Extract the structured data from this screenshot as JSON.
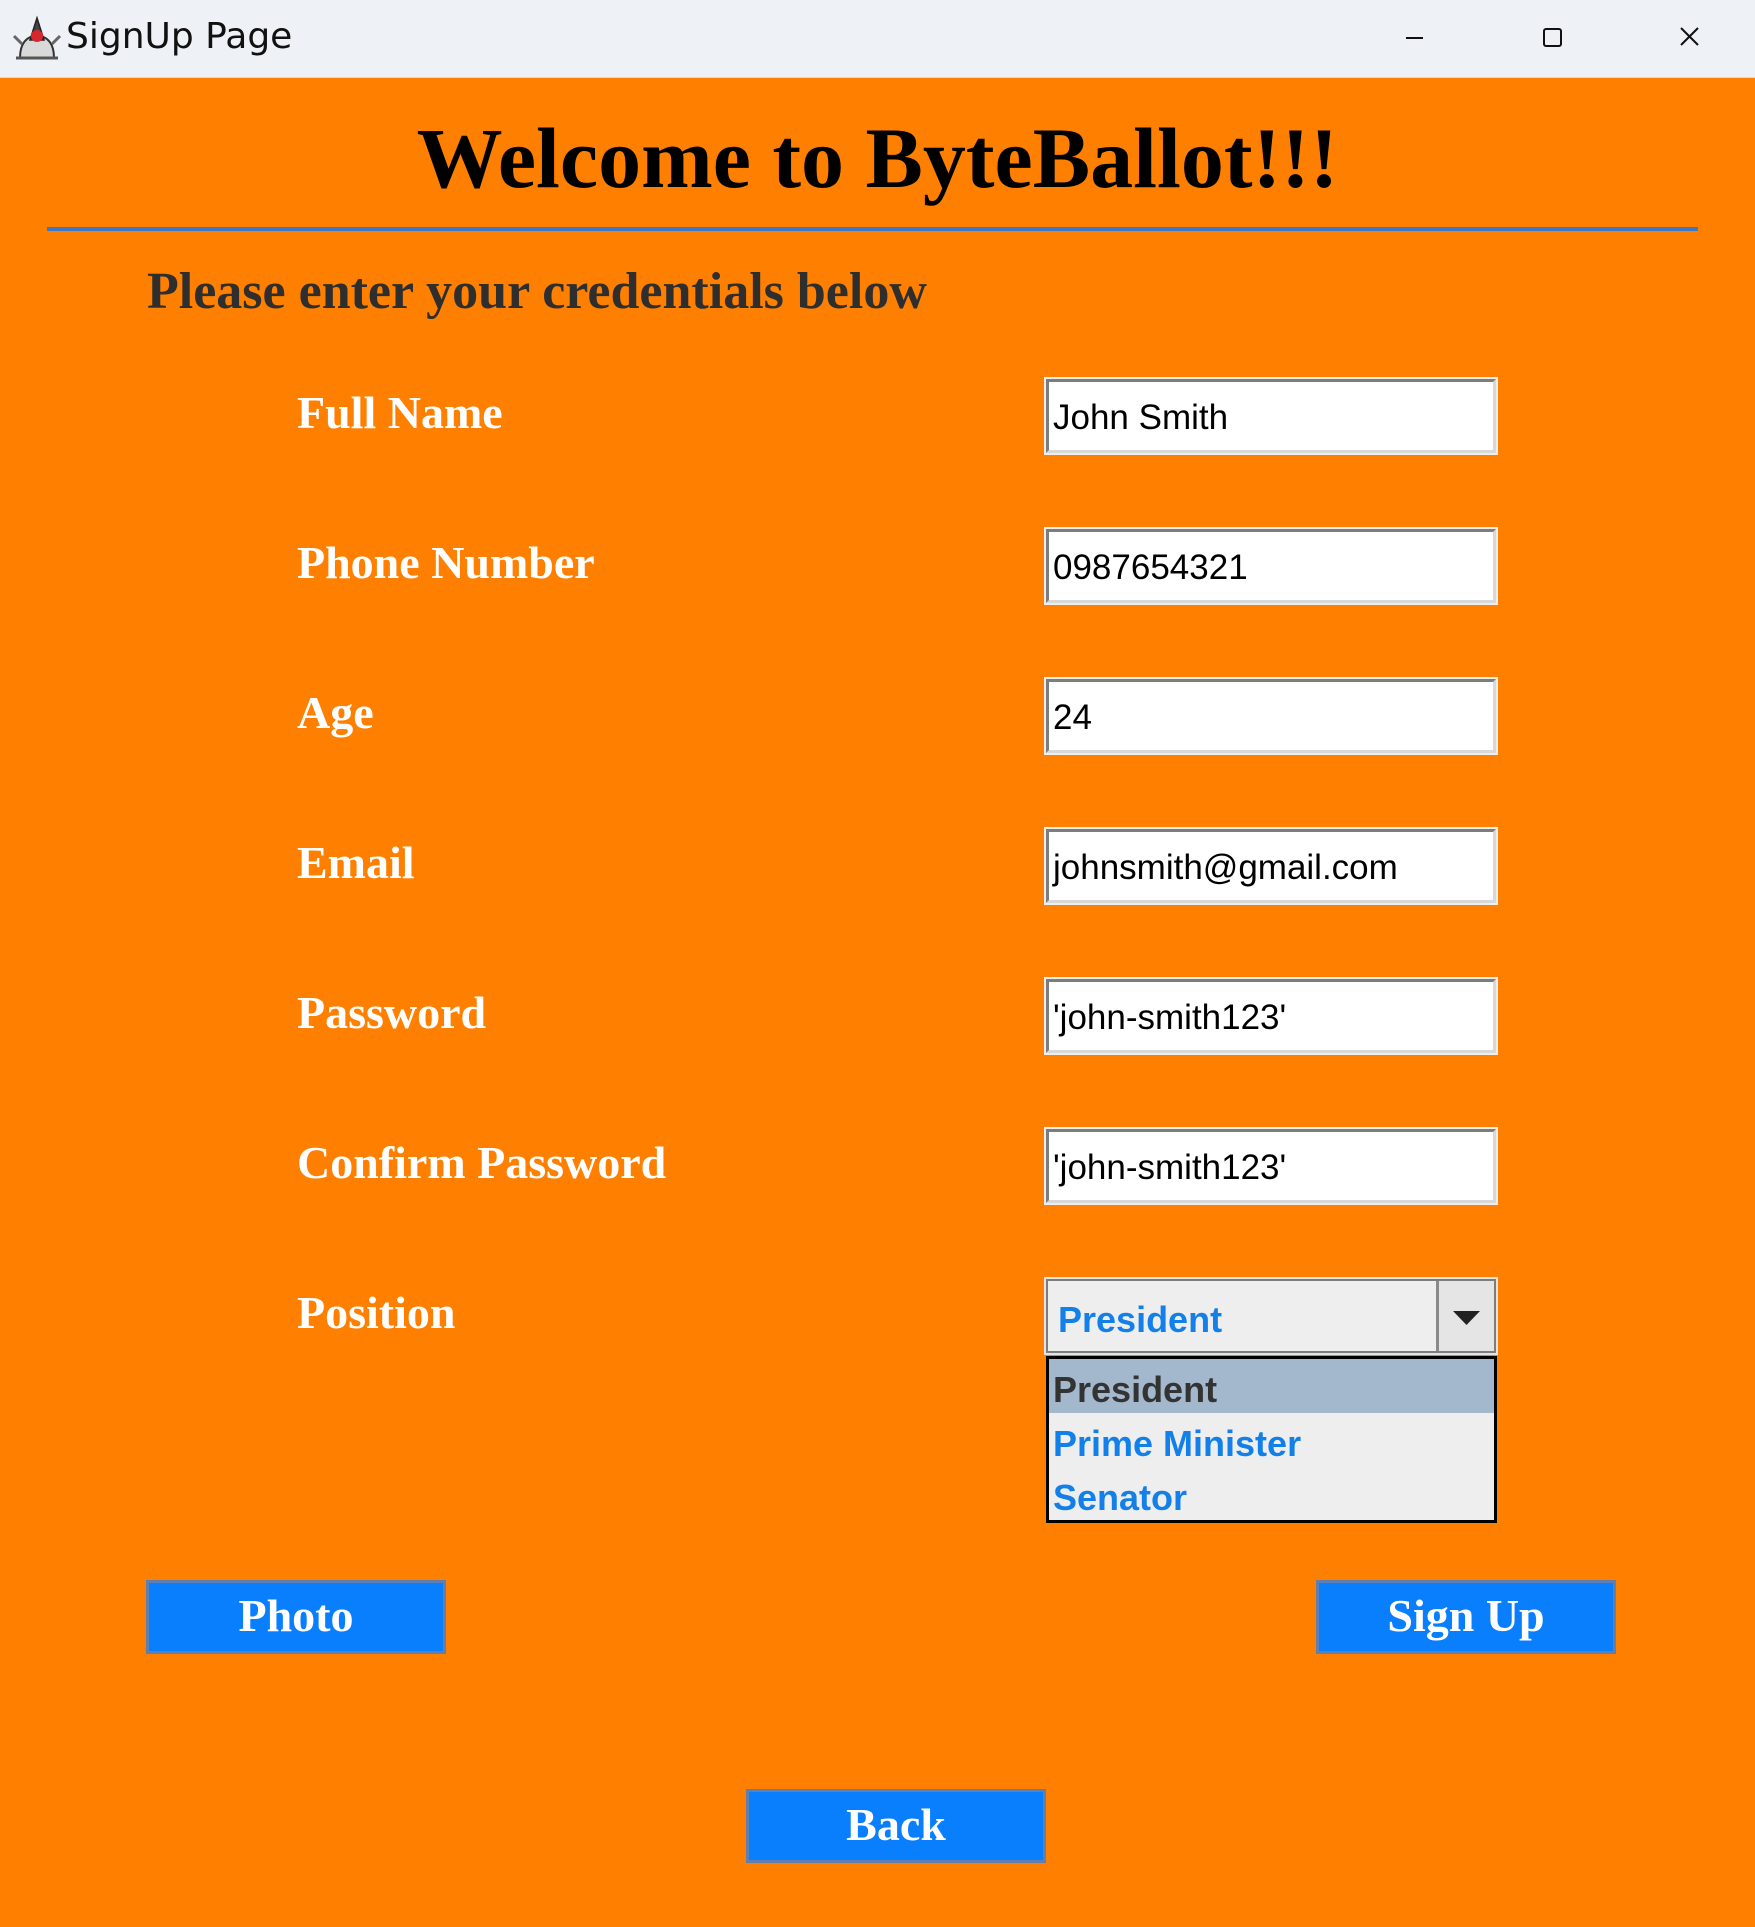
{
  "window": {
    "title": "SignUp Page",
    "controls": [
      "minimize-icon",
      "maximize-icon",
      "close-icon"
    ]
  },
  "heading": "Welcome to ByteBallot!!!",
  "subtitle": "Please enter your credentials below",
  "form": {
    "full_name": {
      "label": "Full Name",
      "value": "John Smith"
    },
    "phone": {
      "label": "Phone Number",
      "value": "0987654321"
    },
    "age": {
      "label": "Age",
      "value": "24"
    },
    "email": {
      "label": "Email",
      "value": "johnsmith@gmail.com"
    },
    "password": {
      "label": "Password",
      "value": "'john-smith123'"
    },
    "confirm_password": {
      "label": "Confirm Password",
      "value": "'john-smith123'"
    },
    "position": {
      "label": "Position",
      "selected": "President",
      "options": [
        "President",
        "Prime Minister",
        "Senator"
      ]
    }
  },
  "buttons": {
    "photo": "Photo",
    "signup": "Sign Up",
    "back": "Back"
  },
  "colors": {
    "background": "#ff7f00",
    "button": "#0a7ffd",
    "rule": "#3d77c8",
    "option_text": "#1280e8"
  }
}
